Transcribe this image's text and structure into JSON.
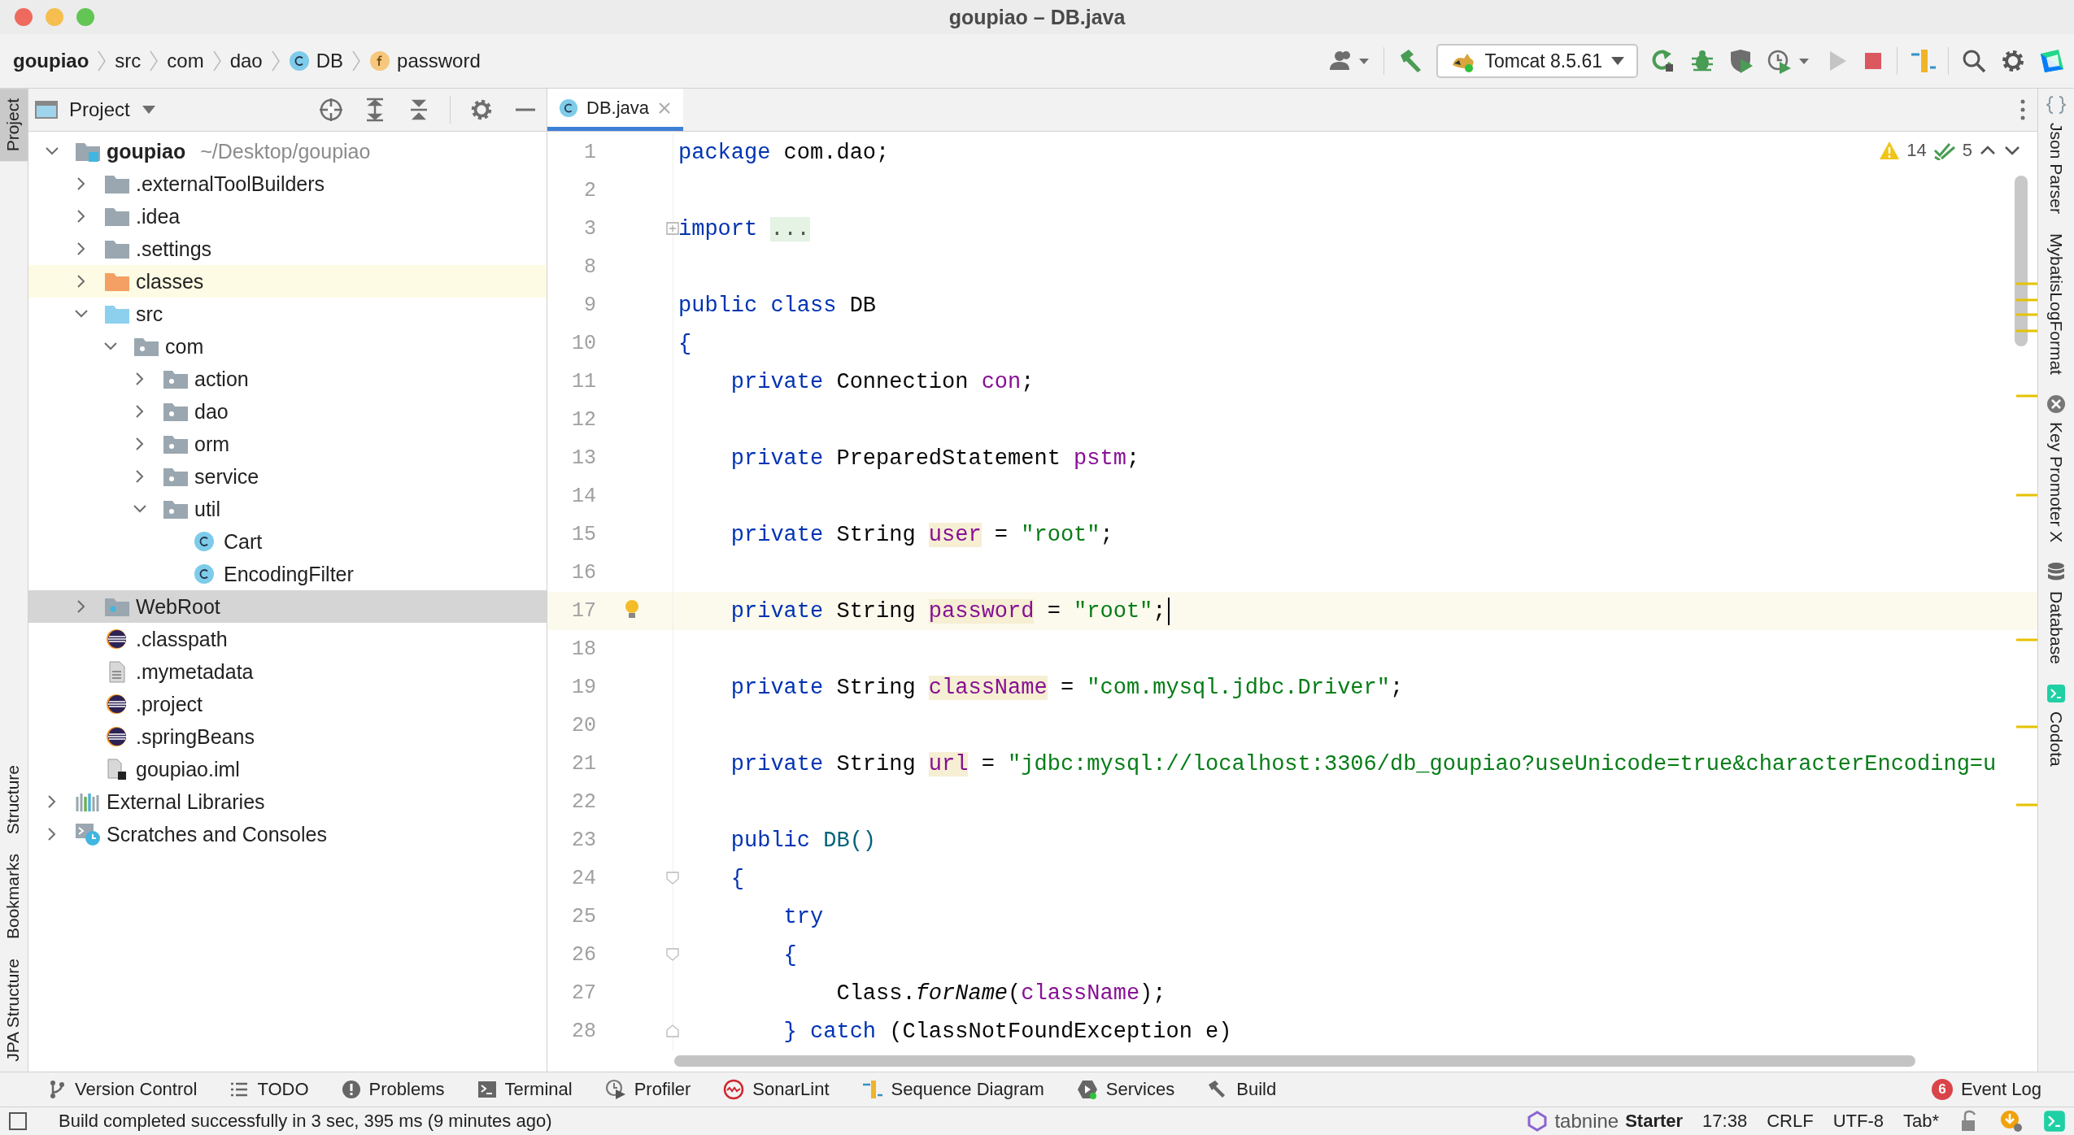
{
  "window": {
    "title": "goupiao – DB.java"
  },
  "breadcrumbs": [
    {
      "label": "goupiao",
      "kind": "project"
    },
    {
      "label": "src",
      "kind": "folder"
    },
    {
      "label": "com",
      "kind": "folder"
    },
    {
      "label": "dao",
      "kind": "folder"
    },
    {
      "label": "DB",
      "kind": "class"
    },
    {
      "label": "password",
      "kind": "field"
    }
  ],
  "toolbar": {
    "run_config": "Tomcat 8.5.61",
    "run_disabled": true
  },
  "left_stripe": {
    "top": [
      {
        "label": "Project",
        "selected": true
      }
    ],
    "bottom": [
      {
        "label": "Structure",
        "selected": false
      },
      {
        "label": "Bookmarks",
        "selected": false
      },
      {
        "label": "JPA Structure",
        "selected": false
      }
    ]
  },
  "project_panel": {
    "title": "Project",
    "tree": [
      {
        "label": "goupiao",
        "path": "~/Desktop/goupiao",
        "kind": "module",
        "expanded": true,
        "selected": false,
        "children": [
          {
            "label": ".externalToolBuilders",
            "kind": "folder",
            "expanded": false,
            "selected": false
          },
          {
            "label": ".idea",
            "kind": "folder",
            "expanded": false,
            "selected": false
          },
          {
            "label": ".settings",
            "kind": "folder",
            "expanded": false,
            "selected": false
          },
          {
            "label": "classes",
            "kind": "excluded",
            "expanded": false,
            "selected": false
          },
          {
            "label": "src",
            "kind": "source",
            "expanded": true,
            "selected": false,
            "children": [
              {
                "label": "com",
                "kind": "package",
                "expanded": true,
                "selected": false,
                "children": [
                  {
                    "label": "action",
                    "kind": "package",
                    "expanded": false,
                    "selected": false
                  },
                  {
                    "label": "dao",
                    "kind": "package",
                    "expanded": false,
                    "selected": false
                  },
                  {
                    "label": "orm",
                    "kind": "package",
                    "expanded": false,
                    "selected": false
                  },
                  {
                    "label": "service",
                    "kind": "package",
                    "expanded": false,
                    "selected": false
                  },
                  {
                    "label": "util",
                    "kind": "package",
                    "expanded": true,
                    "selected": false,
                    "children": [
                      {
                        "label": "Cart",
                        "kind": "class",
                        "selected": false
                      },
                      {
                        "label": "EncodingFilter",
                        "kind": "class",
                        "selected": false
                      }
                    ]
                  }
                ]
              }
            ]
          },
          {
            "label": "WebRoot",
            "kind": "web",
            "expanded": false,
            "selected": true
          },
          {
            "label": ".classpath",
            "kind": "eclipse",
            "selected": false
          },
          {
            "label": ".mymetadata",
            "kind": "file",
            "selected": false
          },
          {
            "label": ".project",
            "kind": "eclipse",
            "selected": false
          },
          {
            "label": ".springBeans",
            "kind": "eclipse",
            "selected": false
          },
          {
            "label": "goupiao.iml",
            "kind": "iml",
            "selected": false
          }
        ]
      },
      {
        "label": "External Libraries",
        "kind": "libraries",
        "expanded": false,
        "selected": false
      },
      {
        "label": "Scratches and Consoles",
        "kind": "scratches",
        "expanded": false,
        "selected": false
      }
    ]
  },
  "editor": {
    "tabs": [
      {
        "label": "DB.java",
        "selected": true
      }
    ],
    "warnings": "14",
    "checks": "5",
    "lines": [
      {
        "number": "1",
        "current": false,
        "tokens": [
          {
            "text": "package",
            "kind": "keyword"
          },
          {
            "text": " com.dao;",
            "kind": "plain"
          }
        ]
      },
      {
        "number": "2",
        "current": false
      },
      {
        "number": "3",
        "current": false,
        "fold": {
          "kind": "collapsed"
        },
        "tokens": [
          {
            "text": "import",
            "kind": "keyword"
          },
          {
            "text": "...",
            "kind": "folded"
          }
        ]
      },
      {
        "number": "8",
        "current": false
      },
      {
        "number": "9",
        "current": false,
        "tokens": [
          {
            "text": "public class",
            "kind": "keyword"
          },
          {
            "text": " DB",
            "kind": "plain"
          }
        ]
      },
      {
        "number": "10",
        "current": false,
        "tokens": [
          {
            "text": "{",
            "kind": "brace"
          }
        ]
      },
      {
        "number": "11",
        "current": false,
        "tokens": [
          {
            "text": "    private",
            "kind": "keyword"
          },
          {
            "text": " Connection ",
            "kind": "plain"
          },
          {
            "text": "con",
            "kind": "field"
          },
          {
            "text": ";",
            "kind": "plain"
          }
        ]
      },
      {
        "number": "12",
        "current": false
      },
      {
        "number": "13",
        "current": false,
        "tokens": [
          {
            "text": "    private",
            "kind": "keyword"
          },
          {
            "text": " PreparedStatement ",
            "kind": "plain"
          },
          {
            "text": "pstm",
            "kind": "field"
          },
          {
            "text": ";",
            "kind": "plain"
          }
        ]
      },
      {
        "number": "14",
        "current": false
      },
      {
        "number": "15",
        "current": false,
        "tokens": [
          {
            "text": "    private",
            "kind": "keyword"
          },
          {
            "text": " String ",
            "kind": "plain"
          },
          {
            "text": "user",
            "kind": "unused"
          },
          {
            "text": " = ",
            "kind": "plain"
          },
          {
            "text": "\"root\"",
            "kind": "string"
          },
          {
            "text": ";",
            "kind": "plain"
          }
        ]
      },
      {
        "number": "16",
        "current": false
      },
      {
        "number": "17",
        "current": true,
        "gutter_icon": {
          "kind": "bulb"
        },
        "tokens": [
          {
            "text": "    private",
            "kind": "keyword"
          },
          {
            "text": " String ",
            "kind": "plain"
          },
          {
            "text": "password",
            "kind": "unused"
          },
          {
            "text": " = ",
            "kind": "plain"
          },
          {
            "text": "\"root\"",
            "kind": "string"
          },
          {
            "text": ";",
            "kind": "plain"
          }
        ]
      },
      {
        "number": "18",
        "current": false
      },
      {
        "number": "19",
        "current": false,
        "tokens": [
          {
            "text": "    private",
            "kind": "keyword"
          },
          {
            "text": " String ",
            "kind": "plain"
          },
          {
            "text": "className",
            "kind": "unused"
          },
          {
            "text": " = ",
            "kind": "plain"
          },
          {
            "text": "\"com.mysql.jdbc.Driver\"",
            "kind": "string"
          },
          {
            "text": ";",
            "kind": "plain"
          }
        ]
      },
      {
        "number": "20",
        "current": false
      },
      {
        "number": "21",
        "current": false,
        "tokens": [
          {
            "text": "    private",
            "kind": "keyword"
          },
          {
            "text": " String ",
            "kind": "plain"
          },
          {
            "text": "url",
            "kind": "unused"
          },
          {
            "text": " = ",
            "kind": "plain"
          },
          {
            "text": "\"jdbc:mysql://localhost:3306/db_goupiao?useUnicode=true&characterEncoding=u",
            "kind": "string"
          }
        ]
      },
      {
        "number": "22",
        "current": false
      },
      {
        "number": "23",
        "current": false,
        "tokens": [
          {
            "text": "    public",
            "kind": "keyword"
          },
          {
            "text": " DB()",
            "kind": "method"
          }
        ]
      },
      {
        "number": "24",
        "current": false,
        "fold": {
          "kind": "open"
        },
        "tokens": [
          {
            "text": "    {",
            "kind": "brace"
          }
        ]
      },
      {
        "number": "25",
        "current": false,
        "tokens": [
          {
            "text": "        try",
            "kind": "keyword"
          }
        ]
      },
      {
        "number": "26",
        "current": false,
        "fold": {
          "kind": "open"
        },
        "tokens": [
          {
            "text": "        {",
            "kind": "brace"
          }
        ]
      },
      {
        "number": "27",
        "current": false,
        "tokens": [
          {
            "text": "            Class.",
            "kind": "plain"
          },
          {
            "text": "forName",
            "kind": "static"
          },
          {
            "text": "(",
            "kind": "plain"
          },
          {
            "text": "className",
            "kind": "field"
          },
          {
            "text": ");",
            "kind": "plain"
          }
        ]
      },
      {
        "number": "28",
        "current": false,
        "fold": {
          "kind": "end"
        },
        "tokens": [
          {
            "text": "        } ",
            "kind": "brace"
          },
          {
            "text": "catch",
            "kind": "keyword"
          },
          {
            "text": " (ClassNotFoundException e)",
            "kind": "plain"
          }
        ]
      }
    ]
  },
  "right_stripe": [
    {
      "label": "Json Parser",
      "kind": "json"
    },
    {
      "label": "MybatisLogFormat",
      "kind": "none"
    },
    {
      "label": "Key Promoter X",
      "kind": "keypromoter"
    },
    {
      "label": "Database",
      "kind": "database"
    },
    {
      "label": "Codota",
      "kind": "codota"
    }
  ],
  "tool_windows": [
    {
      "label": "Version Control",
      "kind": "vcs"
    },
    {
      "label": "TODO",
      "kind": "todo"
    },
    {
      "label": "Problems",
      "kind": "problems"
    },
    {
      "label": "Terminal",
      "kind": "terminal"
    },
    {
      "label": "Profiler",
      "kind": "profiler"
    },
    {
      "label": "SonarLint",
      "kind": "sonarlint"
    },
    {
      "label": "Sequence Diagram",
      "kind": "sequence"
    },
    {
      "label": "Services",
      "kind": "services"
    },
    {
      "label": "Build",
      "kind": "build"
    }
  ],
  "event_log": {
    "label": "Event Log",
    "badge": "6"
  },
  "status_bar": {
    "message": "Build completed successfully in 3 sec, 395 ms (9 minutes ago)",
    "brand": "tabnine",
    "plan": "Starter",
    "items": [
      "17:38",
      "CRLF",
      "UTF-8",
      "Tab*"
    ]
  }
}
